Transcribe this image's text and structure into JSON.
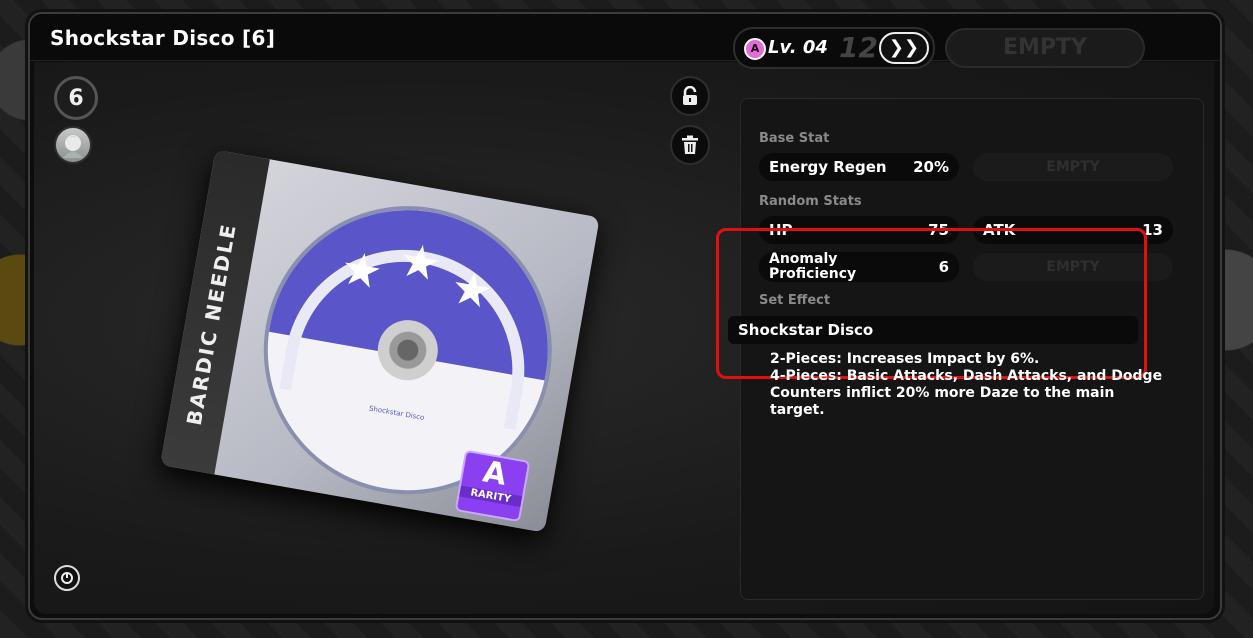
{
  "title": "Shockstar Disco [6]",
  "slot_number": "6",
  "level": {
    "rank_letter": "A",
    "label": "Lv. 04",
    "max": "12",
    "upgrade_glyph": "❯❯"
  },
  "empty_label": "EMPTY",
  "base_stat": {
    "heading": "Base Stat",
    "name": "Energy Regen",
    "value": "20%"
  },
  "random_stats": {
    "heading": "Random Stats",
    "items": [
      {
        "name": "HP",
        "value": "75"
      },
      {
        "name": "ATK",
        "value": "13"
      },
      {
        "name": "Anomaly Proficiency",
        "value": "6"
      }
    ]
  },
  "set_effect": {
    "heading": "Set Effect",
    "name": "Shockstar Disco",
    "lines": [
      "2-Pieces: Increases Impact by 6%.",
      "4-Pieces: Basic Attacks, Dash Attacks, and Dodge Counters inflict 20% more Daze to the main target."
    ]
  },
  "disc": {
    "spine_text": "BARDIC NEEDLE",
    "disc_label": "Shockstar Disco",
    "rarity_letter": "A",
    "rarity_text": "RARITY"
  },
  "icons": {
    "lock": "lock-icon",
    "trash": "trash-icon",
    "info": "info-icon"
  },
  "colors": {
    "highlight_border": "#e01010",
    "rarity_purple": "#8a3ff0",
    "disc_purple": "#5a55c8"
  }
}
